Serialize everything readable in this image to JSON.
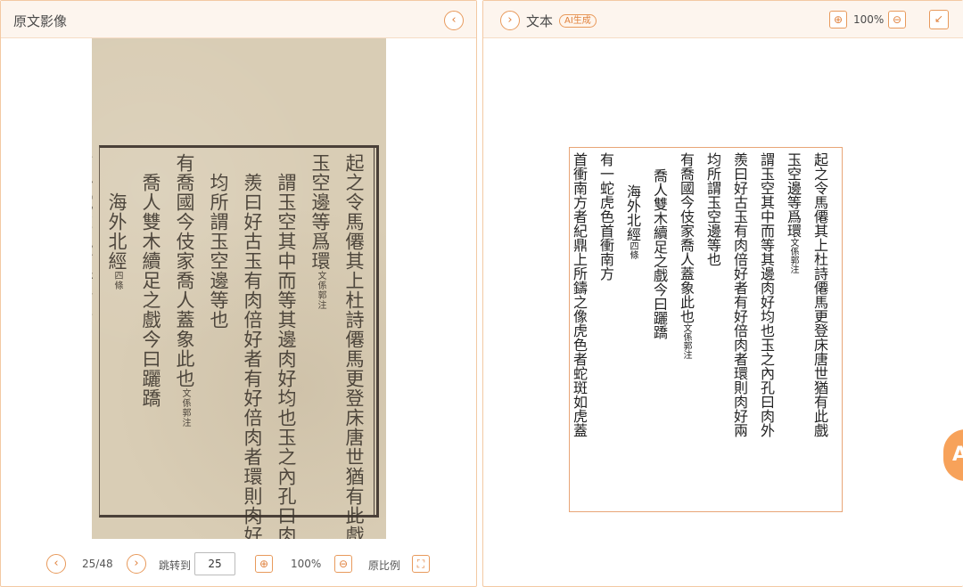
{
  "left_panel": {
    "title": "原文影像",
    "collapse_icon": "chevron-left-icon",
    "scan_columns": [
      {
        "text": "起之令馬僊其上杜詩僊馬更登床唐世猶有此戲",
        "indent": 0
      },
      {
        "text": "玉空邊等爲環",
        "note": "文係郭注",
        "indent": 0
      },
      {
        "text": "謂玉空其中而等其邊肉好均也玉之內孔曰肉外",
        "indent": 1
      },
      {
        "text": "羨曰好古玉有肉倍好者有好倍肉者環則肉好兩",
        "indent": 1
      },
      {
        "text": "均所謂玉空邊等也",
        "indent": 1
      },
      {
        "text": "有喬國今伎家喬人蓋象此也",
        "note": "文係郭注",
        "indent": 0
      },
      {
        "text": "喬人雙木續足之戲今曰躧蹻",
        "indent": 1
      },
      {
        "text": "海外北經",
        "note": "四條",
        "indent": 2
      },
      {
        "text": "有一蛇虎色首衝南方",
        "indent": 0
      },
      {
        "text": "首衝南方者紀鼎上所鑄之像虎色者蛇斑如虎蓋",
        "indent": 1
      }
    ],
    "footer": {
      "page_indicator": "25/48",
      "jump_label": "跳转到",
      "jump_value": "25",
      "zoom_level": "100%",
      "original_ratio_label": "原比例"
    }
  },
  "right_panel": {
    "title": "文本",
    "ai_badge": "AI生成",
    "zoom_level": "100%",
    "transcript_columns": [
      {
        "text": "起之令馬僊其上杜詩僊馬更登床唐世猶有此戲",
        "indent": 0
      },
      {
        "text": "玉空邊等爲環",
        "note": "文係郭注",
        "indent": 0
      },
      {
        "text": "謂玉空其中而等其邊肉好均也玉之內孔曰肉外",
        "indent": 0
      },
      {
        "text": "羨曰好古玉有肉倍好者有好倍肉者環則肉好兩",
        "indent": 0
      },
      {
        "text": "均所謂玉空邊等也",
        "indent": 0
      },
      {
        "text": "有喬國今伎家喬人蓋象此也",
        "note": "文係郭注",
        "indent": 0
      },
      {
        "text": "喬人雙木續足之戲今曰躧蹻",
        "indent": 1
      },
      {
        "text": "海外北經",
        "note": "四條",
        "indent": 2
      },
      {
        "text": "有一蛇虎色首衝南方",
        "indent": 0
      },
      {
        "text": "首衝南方者紀鼎上所鑄之像虎色者蛇斑如虎蓋",
        "indent": 0
      }
    ],
    "side_badge": "A"
  },
  "colors": {
    "accent": "#e0823e",
    "header_bg": "#fdf5ee",
    "border": "#f3c9a3",
    "paper": "#d9cdb5"
  }
}
